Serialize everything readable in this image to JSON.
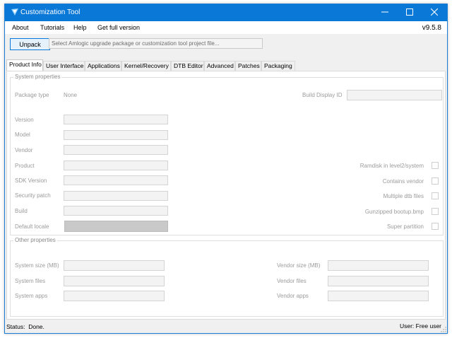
{
  "window": {
    "title": "Customization Tool",
    "accent_color": "#0a78d7",
    "icons": [
      "app-icon",
      "minimize-icon",
      "maximize-icon",
      "close-icon"
    ]
  },
  "menu": {
    "items": [
      "About",
      "Tutorials",
      "Help",
      "Get full version"
    ],
    "version": "v9.5.8"
  },
  "toolbar": {
    "unpack_label": "Unpack",
    "path_placeholder": "Select Amlogic upgrade package or customization tool project file..."
  },
  "tabs": [
    "Product Info",
    "User Interface",
    "Applications",
    "Kernel/Recovery",
    "DTB Editor",
    "Advanced",
    "Patches",
    "Packaging"
  ],
  "active_tab": "Product Info",
  "system_properties": {
    "legend": "System properties",
    "package_type_label": "Package type",
    "package_type_value": "None",
    "build_display_id_label": "Build Display ID",
    "fields": [
      "Version",
      "Model",
      "Vendor",
      "Product",
      "SDK Version",
      "Security patch",
      "Build",
      "Default locale"
    ],
    "checkboxes": [
      "Ramdisk in level2/system",
      "Contains vendor",
      "Multiple dtb files",
      "Gunzipped bootup.bmp",
      "Super partition"
    ]
  },
  "other_properties": {
    "legend": "Other properties",
    "left_fields": [
      "System size (MB)",
      "System files",
      "System apps"
    ],
    "right_fields": [
      "Vendor size (MB)",
      "Vendor files",
      "Vendor apps"
    ]
  },
  "status": {
    "label": "Status:",
    "value": "Done.",
    "user": "User: Free user"
  }
}
